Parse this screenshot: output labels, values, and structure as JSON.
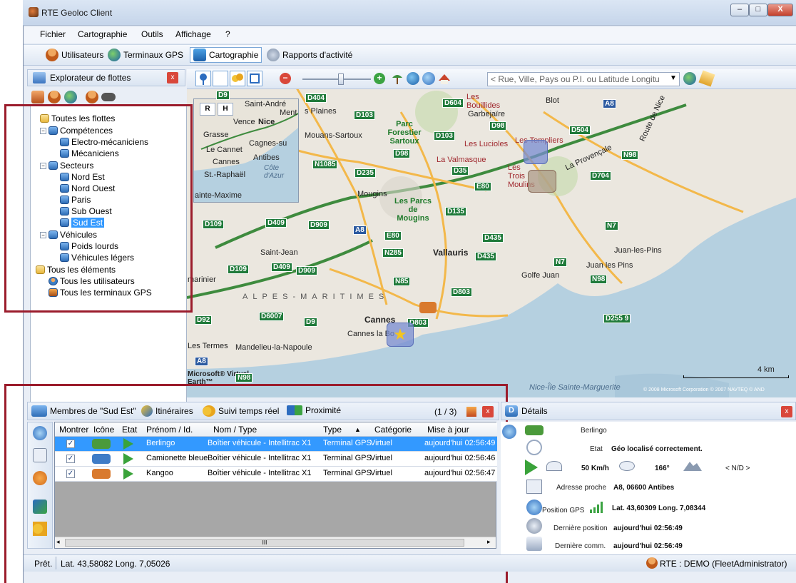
{
  "window": {
    "title": "RTE Geoloc Client",
    "controls": [
      "–",
      "□",
      "X"
    ]
  },
  "menu": [
    "Fichier",
    "Cartographie",
    "Outils",
    "Affichage",
    "?"
  ],
  "toolbar": {
    "users": "Utilisateurs",
    "gps_terminals": "Terminaux GPS",
    "mapping": "Cartographie",
    "reports": "Rapports d'activité"
  },
  "explorer": {
    "title": "Explorateur de flottes",
    "close": "x",
    "tree": {
      "all_fleets": "Toutes les flottes",
      "skills": "Compétences",
      "skills_items": [
        "Electro-mécaniciens",
        "Mécaniciens"
      ],
      "sectors": "Secteurs",
      "sectors_items": [
        "Nord Est",
        "Nord Ouest",
        "Paris",
        "Sub Ouest",
        "Sud Est"
      ],
      "vehicles": "Véhicules",
      "vehicles_items": [
        "Poids lourds",
        "Véhicules légers"
      ],
      "all_elements": "Tous les éléments",
      "all_users": "Tous les utilisateurs",
      "all_gps": "Tous les terminaux GPS"
    }
  },
  "map": {
    "search_placeholder": "< Rue, Ville, Pays ou P.I. ou Latitude Longitu",
    "minimap_buttons": [
      "R",
      "H"
    ],
    "scale": "4 km",
    "copyright": "© 2008 Microsoft Corporation  © 2007 NAVTEQ  © AND",
    "brand": "Microsoft® Virtual Earth™",
    "places": {
      "blot": "Blot",
      "plaines": "s Plaines",
      "garbejaire": "Garbejaïre",
      "les_bouillides": "Les Bouillides",
      "parc_forestier": "Parc Forestier Sartoux",
      "mouans": "Mouans-Sartoux",
      "les_lucioles": "Les Lucioles",
      "les_templiers": "Les Templiers",
      "la_valmasque": "La Valmasque",
      "les_trois_moulins": "Les Trois Moulins",
      "la_provencale": "La Provençale",
      "mougins": "Mougins",
      "les_parcs": "Les Parcs de Mougins",
      "vallauris": "Vallauris",
      "juan_les_pins": "Juan-les-Pins",
      "juan_les_pins2": "Juan les Pins",
      "golfe_juan": "Golfe Juan",
      "saint_jean": "Saint-Jean",
      "alpes_maritimes": "ALPES-MARITIMES",
      "marinier": "marinier",
      "cannes": "Cannes",
      "cannes_la_bocca": "Cannes la Bo",
      "les_termes": "Les Termes",
      "mandelieu": "Mandelieu-la-Napoule",
      "sainte_marguerite": "Nice-Île Sainte-Marguerite",
      "route_de_nice": "Route de Nice",
      "grasse": "Grasse",
      "le_cannet": "Le Cannet",
      "cannes_mini": "Cannes",
      "cagnes": "Cagnes-su",
      "antibes": "Antibes",
      "nice": "Nice",
      "vence": "Vence",
      "saint_andre": "Saint-André",
      "menton": "Ment",
      "st_raphael": "St.-Raphaël",
      "cote_azur": "Côte d'Azur",
      "sainte_maxime": "ainte-Maxime"
    },
    "roads": [
      "D404",
      "D103",
      "D604",
      "A8",
      "D98",
      "D504",
      "D103",
      "N98",
      "D98",
      "D35",
      "D704",
      "N1085",
      "D235",
      "E80",
      "D135",
      "N7",
      "D109",
      "D409",
      "D909",
      "A8",
      "E80",
      "D435",
      "N285",
      "D435",
      "N7",
      "N98",
      "D109",
      "D409",
      "D909",
      "N85",
      "D803",
      "D92",
      "D6007",
      "D9",
      "D803",
      "D255 9",
      "A8",
      "N98",
      "D9"
    ]
  },
  "bottom": {
    "tabs": [
      "Membres de \"Sud Est\"",
      "Itinéraires",
      "Suivi temps réel",
      "Proximité"
    ],
    "pager": "(1 / 3)",
    "columns": [
      "Montrer",
      "Icône",
      "Etat",
      "Prénom / Id.",
      "Nom / Type",
      "Type",
      "Catégorie",
      "Mise à jour"
    ],
    "rows": [
      {
        "show": "✓",
        "name": "Berlingo",
        "type_name": "Boîtier véhicule - Intellitrac X1",
        "type": "Terminal GPS",
        "category": "Virtuel",
        "updated": "aujourd'hui 02:56:49"
      },
      {
        "show": "✓",
        "name": "Camionette bleue",
        "type_name": "Boîtier véhicule - Intellitrac X1",
        "type": "Terminal GPS",
        "category": "Virtuel",
        "updated": "aujourd'hui 02:56:46"
      },
      {
        "show": "✓",
        "name": "Kangoo",
        "type_name": "Boîtier véhicule - Intellitrac X1",
        "type": "Terminal GPS",
        "category": "Virtuel",
        "updated": "aujourd'hui 02:56:47"
      }
    ],
    "hscroll_label": "III"
  },
  "details": {
    "title": "Détails",
    "vehicle_name": "Berlingo",
    "state_label": "Etat",
    "state_value": "Géo localisé correctement.",
    "speed": "50 Km/h",
    "heading": "166°",
    "altitude": "< N/D >",
    "nearest_label": "Adresse proche",
    "nearest_value": "A8, 06600 Antibes",
    "gps_label": "Position GPS",
    "gps_value": "Lat. 43,60309 Long. 7,08344",
    "last_pos_label": "Dernière position",
    "last_pos_value": "aujourd'hui 02:56:49",
    "last_comm_label": "Dernière comm.",
    "last_comm_value": "aujourd'hui 02:56:49"
  },
  "status": {
    "ready": "Prêt.",
    "coords": "Lat. 43,58082 Long. 7,05026",
    "user": "RTE : DEMO (FleetAdministrator)"
  },
  "colors": {
    "accent": "#3399ff",
    "annotation_red": "#9b1c2c",
    "road_shield": "#1f7a3a"
  }
}
